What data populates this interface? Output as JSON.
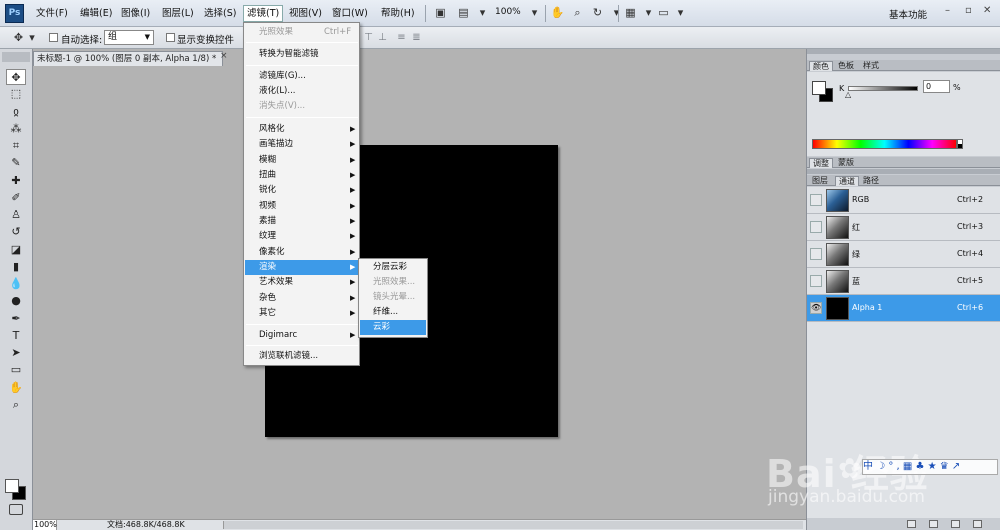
{
  "app": {
    "logo": "Ps"
  },
  "menubar": {
    "items": [
      {
        "label": "文件(F)"
      },
      {
        "label": "编辑(E)"
      },
      {
        "label": "图像(I)"
      },
      {
        "label": "图层(L)"
      },
      {
        "label": "选择(S)"
      },
      {
        "label": "滤镜(T)"
      },
      {
        "label": "视图(V)"
      },
      {
        "label": "窗口(W)"
      },
      {
        "label": "帮助(H)"
      }
    ],
    "zoom": "100%",
    "workspace": "基本功能",
    "window_controls": {
      "minimize": "–",
      "restore": "▫",
      "close": "✕"
    }
  },
  "options_bar": {
    "auto_select_label": "自动选择:",
    "auto_select_value": "组",
    "show_transform_label": "显示变换控件"
  },
  "document": {
    "tab_title": "未标题-1 @ 100% (图层 0 副本, Alpha 1/8) *",
    "tab_close": "×"
  },
  "status_bar": {
    "zoom": "100%",
    "doc_info": "文档:468.8K/468.8K"
  },
  "filter_menu": {
    "items": [
      {
        "label": "光照效果",
        "shortcut": "Ctrl+F",
        "disabled": true
      },
      {
        "label": "转换为智能滤镜"
      },
      {
        "label": "滤镜库(G)..."
      },
      {
        "label": "液化(L)..."
      },
      {
        "label": "消失点(V)...",
        "disabled": true
      },
      {
        "label": "风格化",
        "submenu": true
      },
      {
        "label": "画笔描边",
        "submenu": true
      },
      {
        "label": "模糊",
        "submenu": true
      },
      {
        "label": "扭曲",
        "submenu": true
      },
      {
        "label": "锐化",
        "submenu": true
      },
      {
        "label": "视频",
        "submenu": true
      },
      {
        "label": "素描",
        "submenu": true
      },
      {
        "label": "纹理",
        "submenu": true
      },
      {
        "label": "像素化",
        "submenu": true
      },
      {
        "label": "渲染",
        "submenu": true,
        "highlighted": true
      },
      {
        "label": "艺术效果",
        "submenu": true
      },
      {
        "label": "杂色",
        "submenu": true
      },
      {
        "label": "其它",
        "submenu": true
      },
      {
        "label": "Digimarc",
        "submenu": true
      },
      {
        "label": "浏览联机滤镜..."
      }
    ]
  },
  "render_submenu": {
    "items": [
      {
        "label": "分层云彩"
      },
      {
        "label": "光照效果...",
        "disabled": true
      },
      {
        "label": "镜头光晕...",
        "disabled": true
      },
      {
        "label": "纤维..."
      },
      {
        "label": "云彩",
        "highlighted": true
      }
    ]
  },
  "color_panel": {
    "tabs": [
      "颜色",
      "色板",
      "样式"
    ],
    "channel_label": "K",
    "value": "0",
    "unit": "%"
  },
  "adjust_panel": {
    "tabs": [
      "调整",
      "蒙版"
    ]
  },
  "channels_panel": {
    "tabs": [
      "图层",
      "通道",
      "路径"
    ],
    "rows": [
      {
        "name": "RGB",
        "shortcut": "Ctrl+2"
      },
      {
        "name": "红",
        "shortcut": "Ctrl+3"
      },
      {
        "name": "绿",
        "shortcut": "Ctrl+4"
      },
      {
        "name": "蓝",
        "shortcut": "Ctrl+5"
      },
      {
        "name": "Alpha 1",
        "shortcut": "Ctrl+6",
        "selected": true
      }
    ]
  },
  "watermark": {
    "logo": "Bai  经验",
    "url": "jingyan.baidu.com",
    "ime": "中 ☽ ° , ▦ ♣ ★ ♛ ↗"
  },
  "colors": {
    "highlight": "#3d9ae8",
    "canvas": "#000000",
    "workspace_bg": "#b3b3b3"
  }
}
